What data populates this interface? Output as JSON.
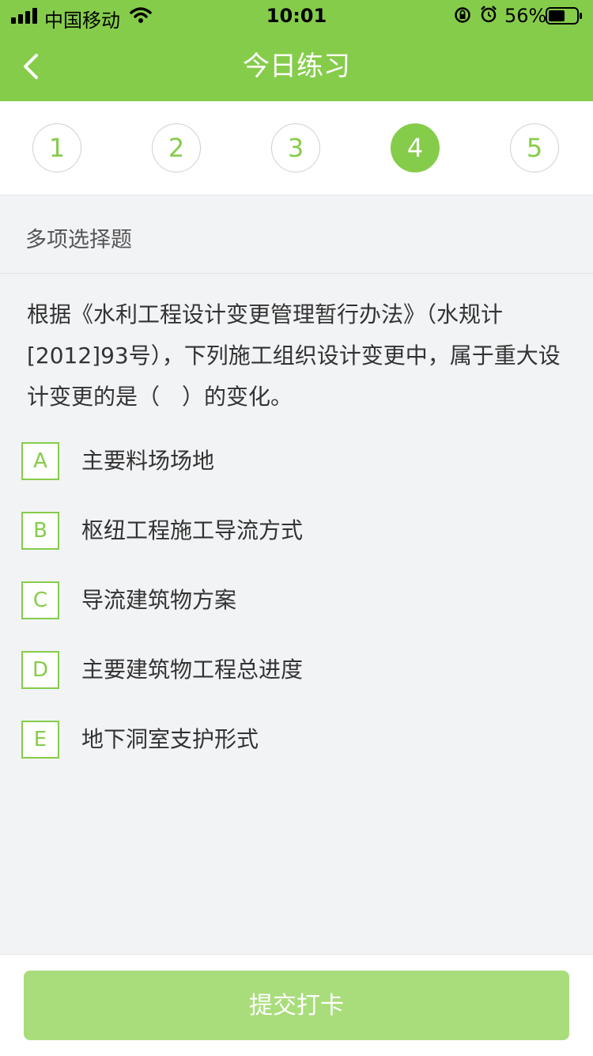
{
  "status_bar": {
    "carrier": "中国移动",
    "time": "10:01",
    "battery": "56%"
  },
  "header": {
    "title": "今日练习",
    "accent_color": "#86cc4b"
  },
  "tabs": [
    {
      "label": "1",
      "active": false
    },
    {
      "label": "2",
      "active": false
    },
    {
      "label": "3",
      "active": false
    },
    {
      "label": "4",
      "active": true
    },
    {
      "label": "5",
      "active": false
    }
  ],
  "question": {
    "type_label": "多项选择题",
    "text": "根据《水利工程设计变更管理暂行办法》（水规计[2012]93号），下列施工组织设计变更中，属于重大设计变更的是（　）的变化。",
    "options": [
      {
        "letter": "A",
        "text": "主要料场场地"
      },
      {
        "letter": "B",
        "text": "枢纽工程施工导流方式"
      },
      {
        "letter": "C",
        "text": "导流建筑物方案"
      },
      {
        "letter": "D",
        "text": "主要建筑物工程总进度"
      },
      {
        "letter": "E",
        "text": "地下洞室支护形式"
      }
    ]
  },
  "footer": {
    "submit_label": "提交打卡"
  }
}
